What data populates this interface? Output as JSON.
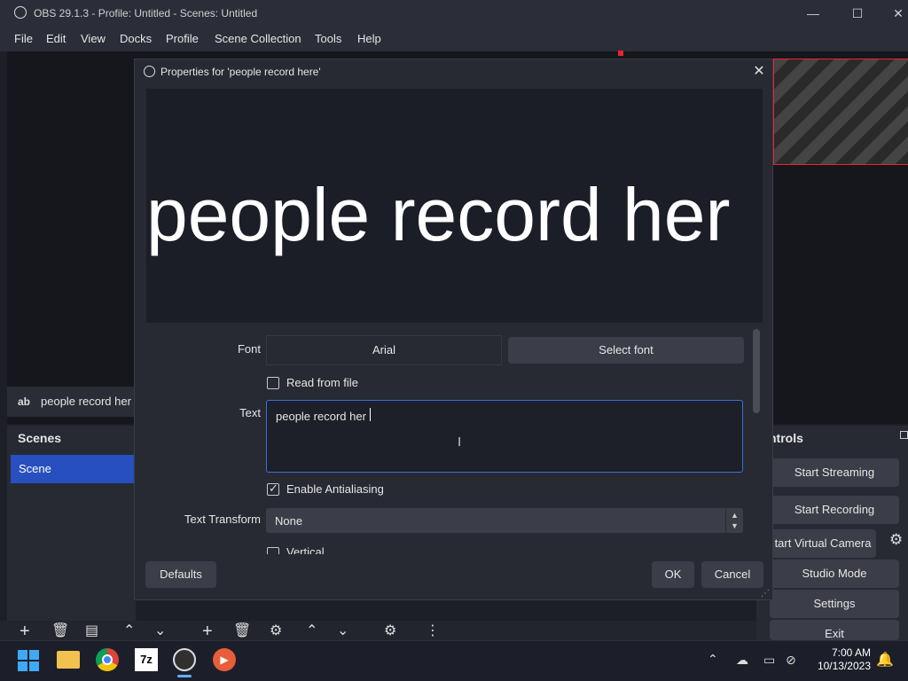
{
  "window": {
    "title": "OBS 29.1.3 - Profile: Untitled - Scenes: Untitled",
    "minimize": "—",
    "maximize": "☐",
    "close": "✕"
  },
  "menu": [
    "File",
    "Edit",
    "View",
    "Docks",
    "Profile",
    "Scene Collection",
    "Tools",
    "Help"
  ],
  "sources": {
    "item_icon": "ab",
    "item_name": "people record her"
  },
  "scenes": {
    "header": "Scenes",
    "items": [
      "Scene"
    ]
  },
  "controls": {
    "header": "ntrols",
    "buttons": [
      "Start Streaming",
      "Start Recording",
      "tart Virtual Camera",
      "Studio Mode",
      "Settings",
      "Exit"
    ]
  },
  "dialog": {
    "title": "Properties for 'people record here'",
    "preview_text": "people record her",
    "font_label": "Font",
    "font_value": "Arial",
    "select_font": "Select font",
    "read_from_file": "Read from file",
    "read_from_file_checked": false,
    "text_label": "Text",
    "text_value": "people record her",
    "enable_antialiasing": "Enable Antialiasing",
    "enable_antialiasing_checked": true,
    "text_transform_label": "Text Transform",
    "text_transform_value": "None",
    "vertical": "Vertical",
    "defaults": "Defaults",
    "ok": "OK",
    "cancel": "Cancel"
  },
  "taskbar": {
    "time": "7:00 AM",
    "date": "10/13/2023",
    "apps": [
      "windows-start-icon",
      "file-explorer-icon",
      "chrome-icon",
      "7zip-icon",
      "obs-icon",
      "media-player-icon"
    ]
  },
  "colors": {
    "accent": "#284fbf",
    "focus_border": "#3b6fd8",
    "source_outline": "#e22233"
  }
}
